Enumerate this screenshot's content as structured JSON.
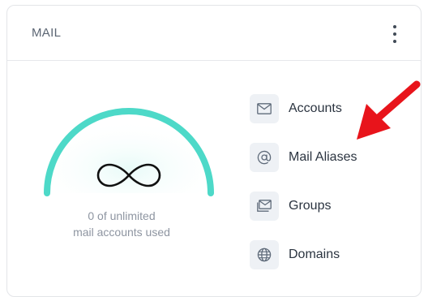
{
  "card": {
    "title": "MAIL",
    "menu_icon": "kebab-menu-icon"
  },
  "gauge": {
    "symbol": "infinity-icon",
    "accent_color": "#4dd9c8",
    "usage_line1": "0 of unlimited",
    "usage_line2": "mail accounts used"
  },
  "menu": {
    "items": [
      {
        "label": "Accounts",
        "icon": "envelope-icon"
      },
      {
        "label": "Mail Aliases",
        "icon": "at-sign-icon"
      },
      {
        "label": "Groups",
        "icon": "group-mail-icon"
      },
      {
        "label": "Domains",
        "icon": "globe-icon"
      }
    ]
  },
  "annotation": {
    "color": "#e8141b",
    "icon": "red-arrow-icon"
  }
}
